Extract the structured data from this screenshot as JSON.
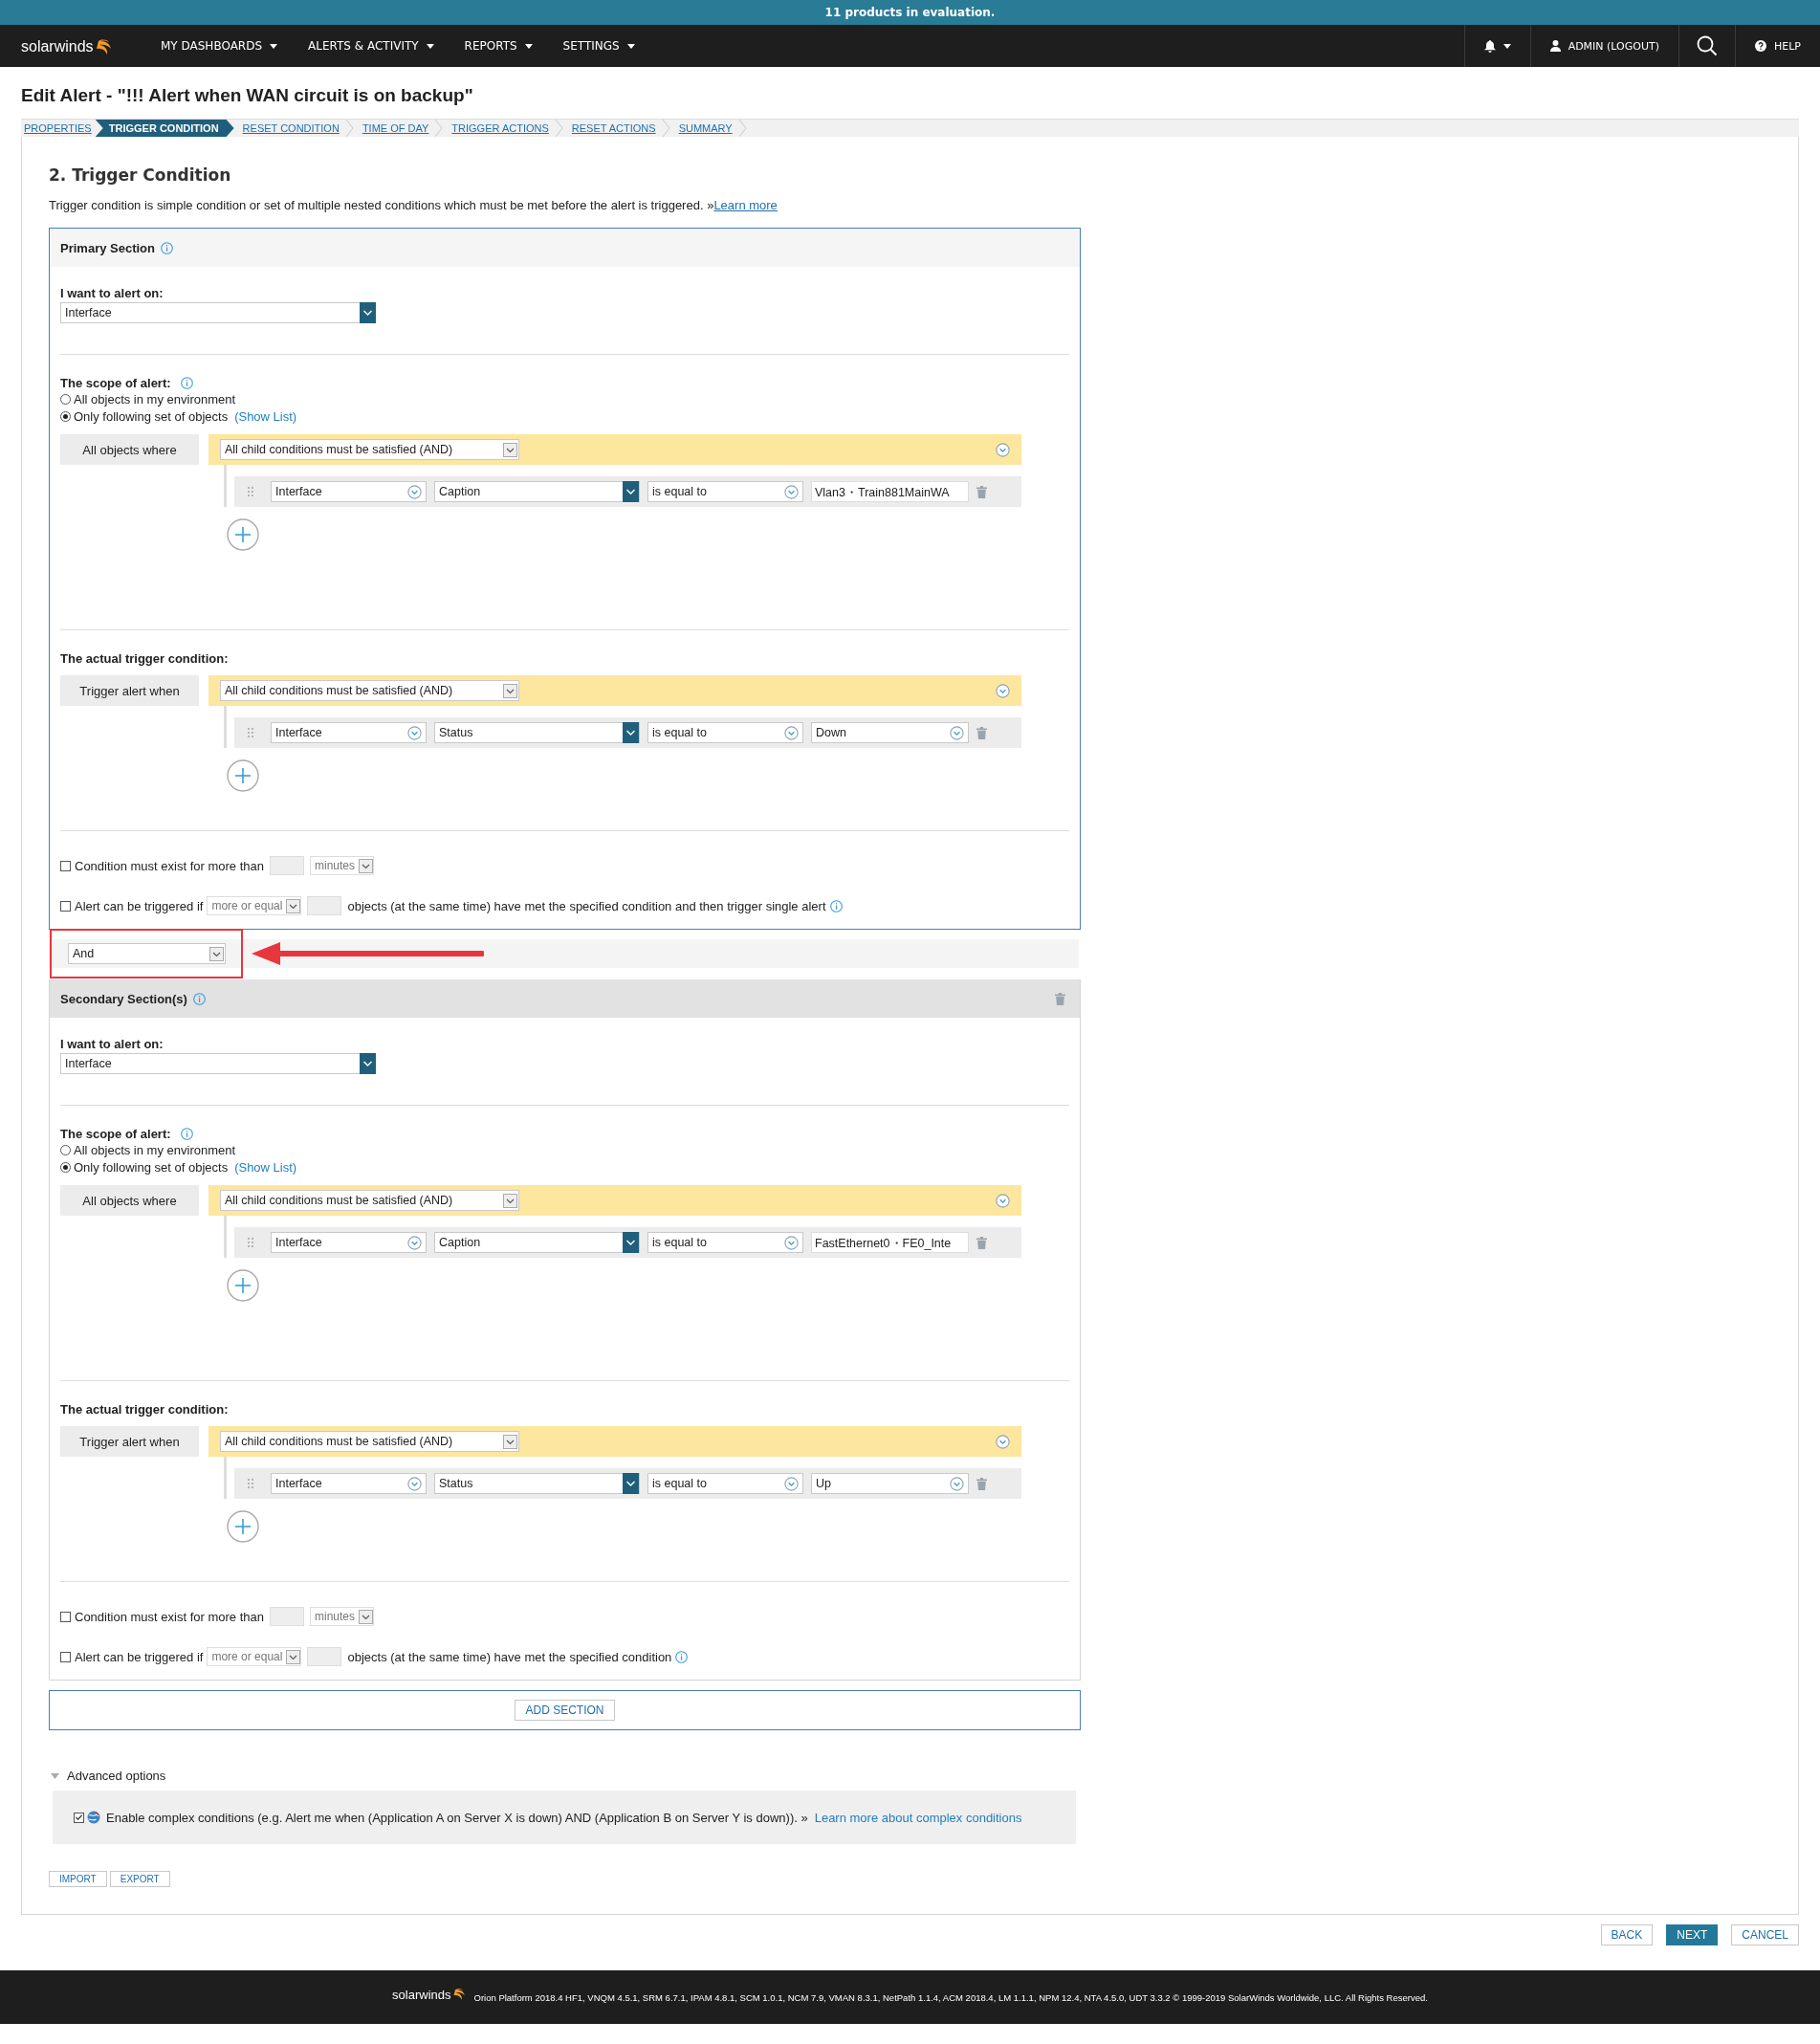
{
  "banner": "11 products in evaluation.",
  "nav": {
    "logo": "solarwinds",
    "menus": [
      {
        "label": "MY DASHBOARDS"
      },
      {
        "label": "ALERTS & ACTIVITY"
      },
      {
        "label": "REPORTS"
      },
      {
        "label": "SETTINGS"
      }
    ],
    "user": "ADMIN (LOGOUT)",
    "help": "HELP"
  },
  "title": "Edit Alert - \"!!! Alert when WAN circuit is on backup\"",
  "steps": [
    {
      "label": "PROPERTIES",
      "selected": false
    },
    {
      "label": "TRIGGER CONDITION",
      "selected": true
    },
    {
      "label": "RESET CONDITION",
      "selected": false
    },
    {
      "label": "TIME OF DAY",
      "selected": false
    },
    {
      "label": "TRIGGER ACTIONS",
      "selected": false
    },
    {
      "label": "RESET ACTIONS",
      "selected": false
    },
    {
      "label": "SUMMARY",
      "selected": false
    }
  ],
  "heading": "2. Trigger Condition",
  "description": "Trigger condition is simple condition or set of multiple nested conditions which must be met before the alert is triggered. »",
  "description_link": "Learn more",
  "sections": [
    {
      "kind": "primary",
      "title": "Primary Section",
      "alert_on_label": "I want to alert on:",
      "alert_on": "Interface",
      "scope_label": "The scope of alert:",
      "scope_options": [
        {
          "label": "All objects in my environment",
          "selected": false
        },
        {
          "label": "Only following set of objects",
          "link": "(Show List)",
          "selected": true
        }
      ],
      "scope_group": {
        "label": "All objects where",
        "operator": "All child conditions must be satisfied (AND)",
        "conditions": [
          {
            "object": "Interface",
            "field": "Caption",
            "comparison": "is equal to",
            "value": "Vlan3・Train881MainWA",
            "kind": "text"
          }
        ]
      },
      "trigger_label": "The actual trigger condition:",
      "trigger_group": {
        "label": "Trigger alert when",
        "operator": "All child conditions must be satisfied (AND)",
        "conditions": [
          {
            "object": "Interface",
            "field": "Status",
            "comparison": "is equal to",
            "value": "Down",
            "kind": "select"
          }
        ]
      },
      "duration": {
        "checked": false,
        "label": "Condition must exist for more than",
        "unit": "minutes"
      },
      "count": {
        "checked": false,
        "label": "Alert can be triggered if",
        "operator": "more or equal",
        "suffix": "objects (at the same time) have met the specified condition and then trigger single alert"
      }
    },
    {
      "kind": "secondary",
      "join": "And",
      "title": "Secondary Section(s)",
      "alert_on_label": "I want to alert on:",
      "alert_on": "Interface",
      "scope_label": "The scope of alert:",
      "scope_options": [
        {
          "label": "All objects in my environment",
          "selected": false
        },
        {
          "label": "Only following set of objects",
          "link": "(Show List)",
          "selected": true
        }
      ],
      "scope_group": {
        "label": "All objects where",
        "operator": "All child conditions must be satisfied (AND)",
        "conditions": [
          {
            "object": "Interface",
            "field": "Caption",
            "comparison": "is equal to",
            "value": "FastEthernet0・FE0_Inte",
            "kind": "text"
          }
        ]
      },
      "trigger_label": "The actual trigger condition:",
      "trigger_group": {
        "label": "Trigger alert when",
        "operator": "All child conditions must be satisfied (AND)",
        "conditions": [
          {
            "object": "Interface",
            "field": "Status",
            "comparison": "is equal to",
            "value": "Up",
            "kind": "select"
          }
        ]
      },
      "duration": {
        "checked": false,
        "label": "Condition must exist for more than",
        "unit": "minutes"
      },
      "count": {
        "checked": false,
        "label": "Alert can be triggered if",
        "operator": "more or equal",
        "suffix": "objects (at the same time) have met the specified condition"
      }
    }
  ],
  "add_section": "ADD SECTION",
  "advanced": {
    "label": "Advanced options",
    "expanded": true,
    "checked": true,
    "text": "Enable complex conditions (e.g. Alert me when (Application A on Server X is down) AND (Application B on Server Y is down)). »",
    "link": "Learn more about complex conditions"
  },
  "file_buttons": [
    "IMPORT",
    "EXPORT"
  ],
  "nav_buttons": [
    {
      "label": "BACK",
      "kind": "plain"
    },
    {
      "label": "NEXT",
      "kind": "primary"
    },
    {
      "label": "CANCEL",
      "kind": "plain"
    }
  ],
  "footer": {
    "logo": "solarwinds",
    "text": "Orion Platform 2018.4 HF1, VNQM 4.5.1, SRM 6.7.1, IPAM 4.8.1, SCM 1.0.1, NCM 7.9, VMAN 8.3.1, NetPath 1.1.4, ACM 2018.4, LM 1.1.1, NPM 12.4, NTA 4.5.0, UDT 3.3.2 © 1999-2019 SolarWinds Worldwide, LLC. All Rights Reserved."
  }
}
